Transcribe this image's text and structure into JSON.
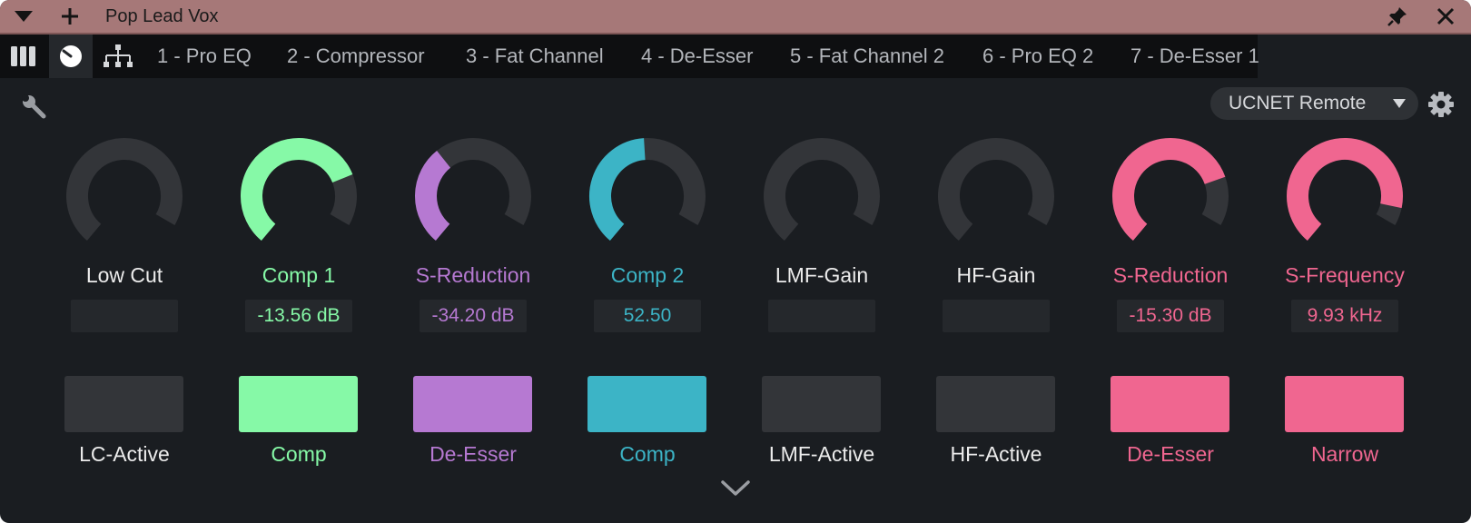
{
  "window": {
    "title": "Pop Lead Vox"
  },
  "tabs": [
    {
      "label": "1 - Pro EQ"
    },
    {
      "label": "2 - Compressor"
    },
    {
      "label": "3 - Fat Channel"
    },
    {
      "label": "4 - De-Esser"
    },
    {
      "label": "5 - Fat Channel 2"
    },
    {
      "label": "6 - Pro EQ 2"
    },
    {
      "label": "7 - De-Esser 1"
    }
  ],
  "remote": {
    "selected": "UCNET Remote"
  },
  "colors": {
    "green": "#86f9a7",
    "purple": "#b679d2",
    "teal": "#3cb4c6",
    "pink": "#f06690",
    "inactive": "#333539"
  },
  "controls": [
    {
      "param": "Low Cut",
      "value": "",
      "color": "inactive",
      "knob_level": 0.0,
      "button": "LC-Active",
      "button_on": false
    },
    {
      "param": "Comp 1",
      "value": "-13.56 dB",
      "color": "green",
      "knob_level": 0.8,
      "button": "Comp",
      "button_on": true
    },
    {
      "param": "S-Reduction",
      "value": "-34.20 dB",
      "color": "purple",
      "knob_level": 0.39,
      "button": "De-Esser",
      "button_on": true
    },
    {
      "param": "Comp 2",
      "value": "52.50",
      "color": "teal",
      "knob_level": 0.525,
      "button": "Comp",
      "button_on": true
    },
    {
      "param": "LMF-Gain",
      "value": "",
      "color": "inactive",
      "knob_level": 0.0,
      "button": "LMF-Active",
      "button_on": false
    },
    {
      "param": "HF-Gain",
      "value": "",
      "color": "inactive",
      "knob_level": 0.0,
      "button": "HF-Active",
      "button_on": false
    },
    {
      "param": "S-Reduction",
      "value": "-15.30 dB",
      "color": "pink",
      "knob_level": 0.81,
      "button": "De-Esser",
      "button_on": true
    },
    {
      "param": "S-Frequency",
      "value": "9.93 kHz",
      "color": "pink",
      "knob_level": 0.93,
      "button": "Narrow",
      "button_on": true
    }
  ],
  "icons": {
    "collapse": "triangle-down-icon",
    "add": "plus-icon",
    "pin": "pin-icon",
    "close": "close-icon",
    "mixer": "mixer-columns-icon",
    "knob": "knob-icon",
    "routing": "routing-icon",
    "wrench": "wrench-icon",
    "gear": "gear-icon",
    "expand": "chevron-down-icon"
  }
}
